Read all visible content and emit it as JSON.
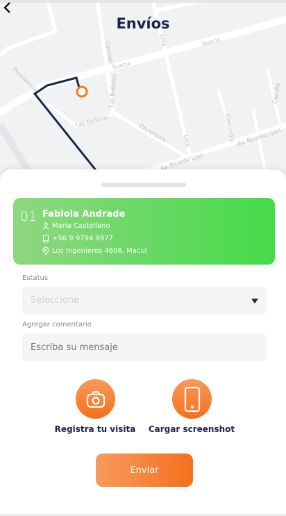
{
  "header": {
    "title": "Envíos",
    "back_icon": "chevron-left-icon"
  },
  "map": {
    "streets": [
      "Suecia",
      "Suecia",
      "Coronel",
      "Lota",
      "Lota",
      "Las Bellotas",
      "Las Bellotas",
      "Coyancura",
      "Av. Ricardo Lyon",
      "Av. Ricardo Lyon",
      "Concordia",
      "Capullo",
      "Providencia"
    ],
    "route_color": "#1c2348",
    "marker_color": "#f47a20"
  },
  "delivery": {
    "number": "01",
    "name": "Fabiola Andrade",
    "contact": "María Castellano",
    "phone": "+56 9 9794 9977",
    "address": "Los Ingenieros 4608, Macul",
    "color_start": "#8fd780",
    "color_end": "#45da4a"
  },
  "form": {
    "status_label": "Estatus",
    "status_placeholder": "Seleccione",
    "comment_label": "Agregar comentario",
    "comment_placeholder": "Escriba su mensaje"
  },
  "actions": [
    {
      "label": "Registra tu visita",
      "icon": "camera-icon"
    },
    {
      "label": "Cargar screenshot",
      "icon": "phone-icon"
    }
  ],
  "submit": {
    "label": "Enviar"
  }
}
